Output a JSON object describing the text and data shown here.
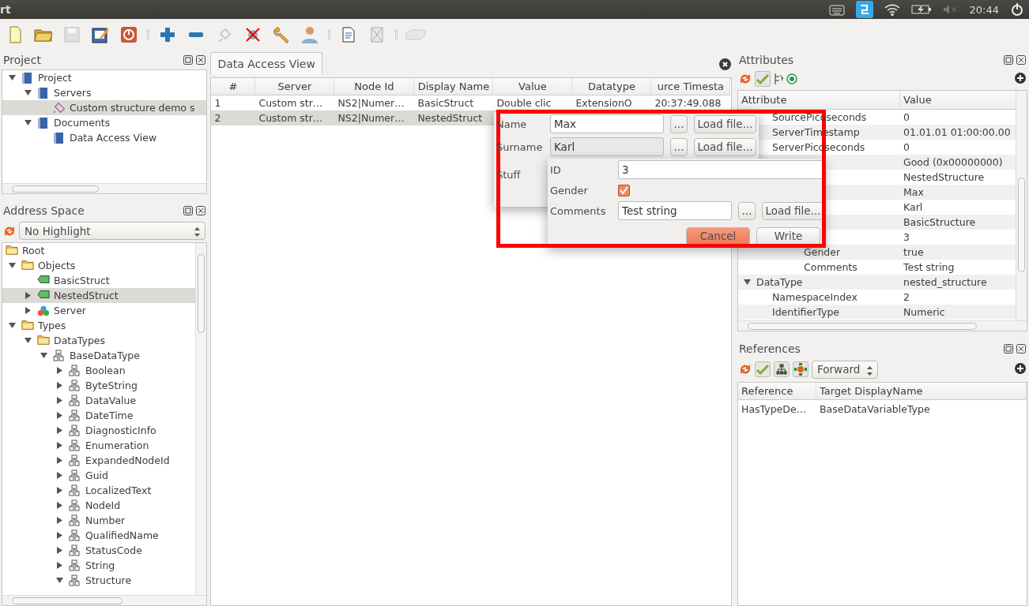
{
  "top_bar": {
    "title": "rt",
    "time": "20:44"
  },
  "toolbar": [
    {
      "kind": "new",
      "disabled": false
    },
    {
      "kind": "open",
      "disabled": false
    },
    {
      "kind": "save",
      "disabled": true
    },
    {
      "kind": "edit",
      "disabled": false
    },
    {
      "kind": "power",
      "disabled": false
    },
    {
      "kind": "separator"
    },
    {
      "kind": "add",
      "disabled": false
    },
    {
      "kind": "remove",
      "disabled": false
    },
    {
      "kind": "plug",
      "disabled": true
    },
    {
      "kind": "disconnect",
      "disabled": false
    },
    {
      "kind": "wrench",
      "disabled": false
    },
    {
      "kind": "user",
      "disabled": false
    },
    {
      "kind": "separator"
    },
    {
      "kind": "document",
      "disabled": false
    },
    {
      "kind": "xdoc",
      "disabled": true
    },
    {
      "kind": "separator"
    },
    {
      "kind": "drive",
      "disabled": true
    }
  ],
  "project": {
    "title": "Project",
    "tree": [
      {
        "label": "Project",
        "kind": "book",
        "expanded": true,
        "selected": false,
        "children": [
          {
            "label": "Servers",
            "kind": "book",
            "expanded": true,
            "selected": false,
            "children": [
              {
                "label": "Custom structure demo s",
                "kind": "plug",
                "selected": true
              }
            ]
          },
          {
            "label": "Documents",
            "kind": "book",
            "expanded": true,
            "selected": false,
            "children": [
              {
                "label": "Data Access View",
                "kind": "book",
                "selected": false
              }
            ]
          }
        ]
      }
    ]
  },
  "address_space": {
    "title": "Address Space",
    "highlight_combo": "No Highlight",
    "tree": [
      {
        "label": "Root",
        "kind": "folder",
        "selected": false,
        "children": [
          {
            "label": "Objects",
            "kind": "folder",
            "expanded": true,
            "selected": false,
            "children": [
              {
                "label": "BasicStruct",
                "kind": "variable",
                "selected": false
              },
              {
                "label": "NestedStruct",
                "kind": "variable",
                "expanded": false,
                "selected": true
              },
              {
                "label": "Server",
                "kind": "object",
                "expanded": false,
                "selected": false
              }
            ]
          },
          {
            "label": "Types",
            "kind": "folder",
            "expanded": true,
            "selected": false,
            "children": [
              {
                "label": "DataTypes",
                "kind": "folder",
                "expanded": true,
                "selected": false,
                "children": [
                  {
                    "label": "BaseDataType",
                    "kind": "datatype",
                    "expanded": true,
                    "selected": false,
                    "children": [
                      {
                        "label": "Boolean",
                        "kind": "datatype",
                        "expanded": false,
                        "selected": false
                      },
                      {
                        "label": "ByteString",
                        "kind": "datatype",
                        "expanded": false,
                        "selected": false
                      },
                      {
                        "label": "DataValue",
                        "kind": "datatype",
                        "expanded": false,
                        "selected": false
                      },
                      {
                        "label": "DateTime",
                        "kind": "datatype",
                        "expanded": false,
                        "selected": false
                      },
                      {
                        "label": "DiagnosticInfo",
                        "kind": "datatype",
                        "expanded": false,
                        "selected": false
                      },
                      {
                        "label": "Enumeration",
                        "kind": "datatype",
                        "expanded": false,
                        "selected": false
                      },
                      {
                        "label": "ExpandedNodeId",
                        "kind": "datatype",
                        "expanded": false,
                        "selected": false
                      },
                      {
                        "label": "Guid",
                        "kind": "datatype",
                        "expanded": false,
                        "selected": false
                      },
                      {
                        "label": "LocalizedText",
                        "kind": "datatype",
                        "expanded": false,
                        "selected": false
                      },
                      {
                        "label": "NodeId",
                        "kind": "datatype",
                        "expanded": false,
                        "selected": false
                      },
                      {
                        "label": "Number",
                        "kind": "datatype",
                        "expanded": false,
                        "selected": false
                      },
                      {
                        "label": "QualifiedName",
                        "kind": "datatype",
                        "expanded": false,
                        "selected": false
                      },
                      {
                        "label": "StatusCode",
                        "kind": "datatype",
                        "expanded": false,
                        "selected": false
                      },
                      {
                        "label": "String",
                        "kind": "datatype",
                        "expanded": false,
                        "selected": false
                      },
                      {
                        "label": "Structure",
                        "kind": "datatype",
                        "expanded": true,
                        "selected": false
                      }
                    ]
                  }
                ]
              }
            ]
          }
        ]
      }
    ]
  },
  "center": {
    "tabs": [
      {
        "label": "Data Access View",
        "selected": true
      }
    ],
    "table": {
      "columns": [
        "#",
        "Server",
        "Node Id",
        "Display Name",
        "Value",
        "Datatype",
        "urce Timesta"
      ],
      "rows": [
        {
          "cells": [
            "1",
            "Custom str…",
            "NS2|Numer…",
            "BasicStruct",
            "Double clic",
            "ExtensionO",
            "20:37:49.088"
          ],
          "selected": false
        },
        {
          "cells": [
            "2",
            "Custom str…",
            "NS2|Numer…",
            "NestedStruct"
          ],
          "selected": true
        }
      ]
    }
  },
  "dialog": {
    "annotation_frame": true,
    "fields": [
      {
        "label": "Name",
        "value": "Max",
        "browse": "...",
        "load": "Load file...",
        "focused": false
      },
      {
        "label": "Surname",
        "value": "Karl",
        "browse": "...",
        "load": "Load file...",
        "focused": true
      }
    ],
    "nested_label": "Stuff",
    "nested": {
      "id_label": "ID",
      "id_value": "3",
      "gender_label": "Gender",
      "gender_checked": true,
      "comments_label": "Comments",
      "comments_value": "Test string",
      "browse": "...",
      "load": "Load file..."
    },
    "buttons": [
      {
        "label": "Cancel",
        "default": true
      },
      {
        "label": "Write",
        "default": false
      }
    ]
  },
  "attributes": {
    "title": "Attributes",
    "columns": [
      "Attribute",
      "Value"
    ],
    "rows": [
      {
        "children": [
          {
            "name": "SourcePicoseconds",
            "value": "0"
          },
          {
            "name": "ServerTimestamp",
            "value": "01.01.01 01:00:00.00"
          },
          {
            "name": "ServerPicoseconds",
            "value": "0"
          },
          {
            "value": "Good (0x00000000)"
          },
          {
            "value": "NestedStructure",
            "children": [
              {
                "value": "Max"
              },
              {
                "value": "Karl"
              },
              {
                "value": "BasicStructure",
                "children": [
                  {
                    "value": "3"
                  },
                  {
                    "name": "Gender",
                    "value": "true"
                  },
                  {
                    "name": "Comments",
                    "value": "Test string"
                  }
                ]
              }
            ]
          }
        ]
      },
      {
        "name": "DataType",
        "value": "nested_structure",
        "expanded": true,
        "children": [
          {
            "name": "NamespaceIndex",
            "value": "2"
          },
          {
            "name": "IdentifierType",
            "value": "Numeric"
          }
        ]
      }
    ]
  },
  "references": {
    "title": "References",
    "direction": "Forward",
    "columns": [
      "Reference",
      "Target DisplayName"
    ],
    "rows": [
      [
        "HasTypeDe…",
        "BaseDataVariableType"
      ]
    ]
  }
}
